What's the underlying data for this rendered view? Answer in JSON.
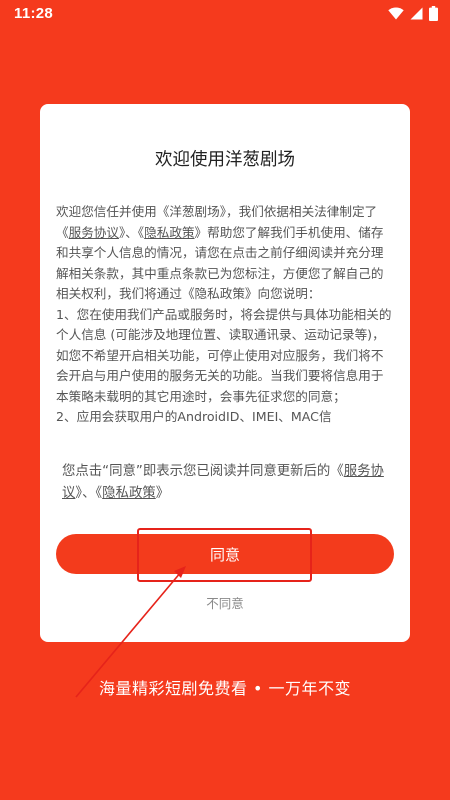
{
  "status_bar": {
    "time": "11:28",
    "icons": [
      "wifi-icon",
      "signal-icon",
      "battery-icon"
    ]
  },
  "dialog": {
    "title": "欢迎使用洋葱剧场",
    "policy": {
      "p1_a": "欢迎您信任并使用《洋葱剧场》，我们依据相关法律制定了《",
      "link_service": "服务协议",
      "p1_b": "》、《",
      "link_privacy": "隐私政策",
      "p1_c": "》帮助您了解我们手机使用、储存和共享个人信息的情况，请您在点击之前仔细阅读并充分理解相关条款，其中重点条款已为您标注，方便您了解自己的相关权利，我们将通过《隐私政策》向您说明：",
      "p2": "1、您在使用我们产品或服务时，将会提供与具体功能相关的个人信息 (可能涉及地理位置、读取通讯录、运动记录等)，如您不希望开启相关功能，可停止使用对应服务，我们将不会开启与用户使用的服务无关的功能。当我们要将信息用于本策略未载明的其它用途时，会事先征求您的同意；",
      "p3": "2、应用会获取用户的AndroidID、IMEI、MAC信"
    },
    "consent": {
      "text_a": "您点击“同意”即表示您已阅读并同意更新后的《",
      "link_service": "服务协议",
      "text_b": "》、《",
      "link_privacy": "隐私政策",
      "text_c": "》"
    },
    "agree_label": "同意",
    "disagree_label": "不同意"
  },
  "slogan": "海量精彩短剧免费看 • 一万年不变",
  "colors": {
    "background": "#f53a1d",
    "button": "#f33b1c",
    "highlight": "#e6231a"
  }
}
